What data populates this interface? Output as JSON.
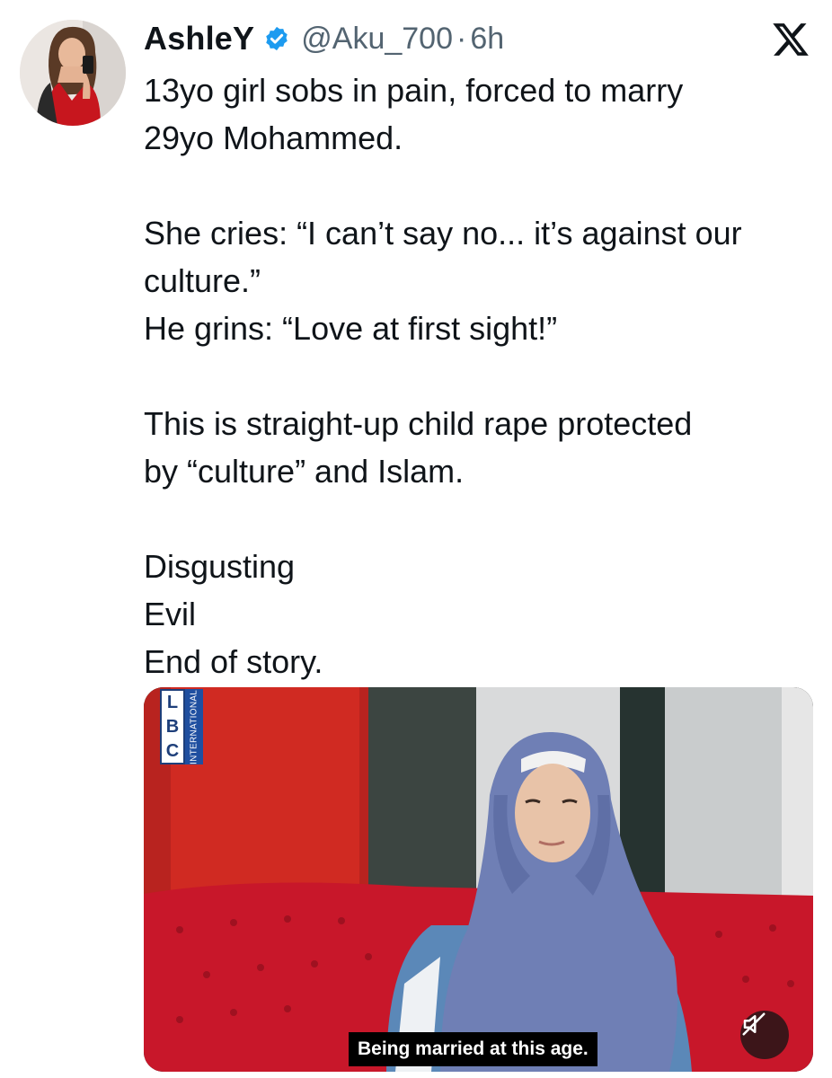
{
  "tweet": {
    "author": {
      "display_name": "AshleY",
      "handle": "@Aku_700",
      "verified": true
    },
    "separator": "·",
    "time": "6h",
    "platform_icon": "x-logo-icon",
    "lines": [
      "13yo girl sobs in pain, forced to marry",
      "29yo Mohammed.",
      "",
      "She cries: “I can’t say no... it’s against our",
      "culture.”",
      "He grins: “Love at first sight!”",
      "",
      "This is straight-up child rape protected",
      "by “culture” and Islam.",
      "",
      "Disgusting",
      "Evil",
      "End of story."
    ],
    "media": {
      "type": "video",
      "watermark": {
        "letters": [
          "L",
          "B",
          "C"
        ],
        "subtext": "INTERNATIONAL"
      },
      "subtitle": "Being married at this age.",
      "mute_icon": "muted-speaker-icon"
    }
  },
  "colors": {
    "text_primary": "#0f1419",
    "text_secondary": "#536471",
    "verified_badge": "#1d9bf0",
    "sofa_red": "#c8172a",
    "hijab_blue": "#6f7fb5"
  }
}
